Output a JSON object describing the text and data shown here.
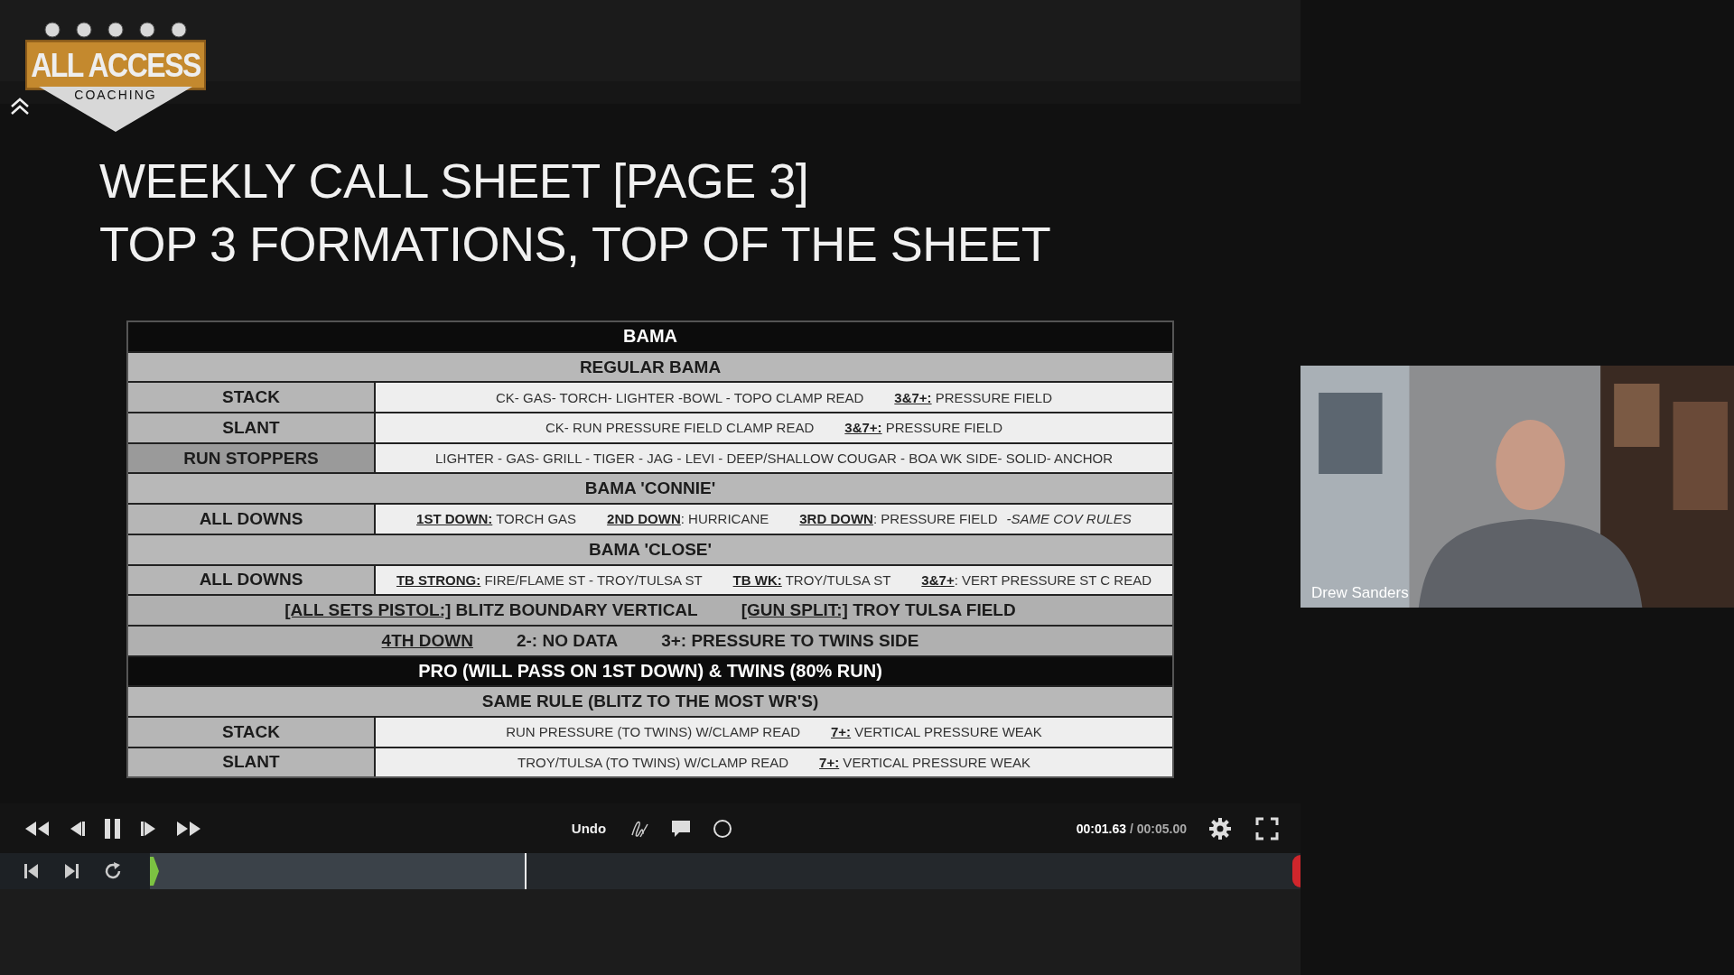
{
  "logo": {
    "title": "ALL ACCESS",
    "subtitle": "COACHING"
  },
  "slide": {
    "title_lines": [
      "WEEKLY CALL SHEET [PAGE 3]",
      "TOP 3 FORMATIONS, TOP OF THE SHEET"
    ],
    "table": {
      "rows": [
        {
          "kind": "header",
          "text": "BAMA"
        },
        {
          "kind": "section",
          "text": "REGULAR BAMA"
        },
        {
          "kind": "entry",
          "label": "STACK",
          "shaded": false,
          "groups": [
            [
              {
                "kind": "plain",
                "text": "CK- GAS- TORCH- LIGHTER -BOWL - TOPO  CLAMP READ"
              }
            ],
            [
              {
                "kind": "key",
                "text": "3&7+:"
              },
              {
                "kind": "plain",
                "text": " PRESSURE FIELD"
              }
            ]
          ]
        },
        {
          "kind": "entry",
          "label": "SLANT",
          "shaded": false,
          "groups": [
            [
              {
                "kind": "plain",
                "text": "CK- RUN PRESSURE FIELD CLAMP READ"
              }
            ],
            [
              {
                "kind": "key",
                "text": "3&7+:"
              },
              {
                "kind": "plain",
                "text": " PRESSURE FIELD"
              }
            ]
          ]
        },
        {
          "kind": "entry",
          "label": "RUN STOPPERS",
          "shaded": true,
          "groups": [
            [
              {
                "kind": "plain",
                "text": "LIGHTER - GAS- GRILL - TIGER - JAG - LEVI - DEEP/SHALLOW COUGAR - BOA WK SIDE- SOLID- ANCHOR"
              }
            ]
          ]
        },
        {
          "kind": "section",
          "text": "BAMA 'CONNIE'"
        },
        {
          "kind": "entry",
          "label": "ALL DOWNS",
          "shaded": false,
          "groups": [
            [
              {
                "kind": "key",
                "text": "1ST DOWN:"
              },
              {
                "kind": "plain",
                "text": " TORCH GAS"
              }
            ],
            [
              {
                "kind": "key",
                "text": "2ND DOWN"
              },
              {
                "kind": "plain",
                "text": ": HURRICANE"
              }
            ],
            [
              {
                "kind": "key",
                "text": "3RD DOWN"
              },
              {
                "kind": "plain",
                "text": ": PRESSURE FIELD"
              },
              {
                "kind": "note",
                "text": "-SAME COV RULES"
              }
            ]
          ]
        },
        {
          "kind": "section",
          "text": "BAMA 'CLOSE'"
        },
        {
          "kind": "entry",
          "label": "ALL DOWNS",
          "shaded": false,
          "groups": [
            [
              {
                "kind": "key",
                "text": "TB STRONG:"
              },
              {
                "kind": "plain",
                "text": " FIRE/FLAME ST - TROY/TULSA ST"
              }
            ],
            [
              {
                "kind": "key",
                "text": "TB WK:"
              },
              {
                "kind": "plain",
                "text": " TROY/TULSA ST"
              }
            ],
            [
              {
                "kind": "key",
                "text": "3&7+"
              },
              {
                "kind": "plain",
                "text": ":  VERT PRESSURE ST C READ"
              }
            ]
          ]
        },
        {
          "kind": "band",
          "groups": [
            [
              {
                "kind": "key",
                "text": "[ALL SETS PISTOL:]"
              },
              {
                "kind": "plain",
                "text": " BLITZ BOUNDARY VERTICAL"
              }
            ],
            [
              {
                "kind": "key",
                "text": "[GUN SPLIT:]"
              },
              {
                "kind": "plain",
                "text": " TROY TULSA FIELD"
              }
            ]
          ]
        },
        {
          "kind": "band",
          "groups": [
            [
              {
                "kind": "key",
                "text": "4TH DOWN"
              }
            ],
            [
              {
                "kind": "plain",
                "text": "2-: NO DATA"
              }
            ],
            [
              {
                "kind": "plain",
                "text": "3+: PRESSURE TO TWINS SIDE"
              }
            ]
          ]
        },
        {
          "kind": "header",
          "text": "PRO (WILL PASS ON 1ST DOWN) & TWINS (80% RUN)"
        },
        {
          "kind": "section",
          "text": "SAME RULE (BLITZ TO THE MOST WR'S)"
        },
        {
          "kind": "entry",
          "label": "STACK",
          "shaded": false,
          "groups": [
            [
              {
                "kind": "plain",
                "text": "RUN PRESSURE (TO TWINS) W/CLAMP READ"
              }
            ],
            [
              {
                "kind": "key",
                "text": "7+:"
              },
              {
                "kind": "plain",
                "text": " VERTICAL PRESSURE WEAK"
              }
            ]
          ]
        },
        {
          "kind": "entry",
          "label": "SLANT",
          "shaded": false,
          "groups": [
            [
              {
                "kind": "plain",
                "text": "TROY/TULSA (TO TWINS) W/CLAMP READ"
              }
            ],
            [
              {
                "kind": "key",
                "text": "7+:"
              },
              {
                "kind": "plain",
                "text": " VERTICAL PRESSURE WEAK"
              }
            ]
          ]
        }
      ]
    }
  },
  "player": {
    "playing": true,
    "undo": "Undo",
    "time_current": "00:01.63",
    "time_separator": "/",
    "time_total": "00:05.00",
    "playhead": {
      "level": 0.326
    }
  },
  "webcam": {
    "kind": "picture",
    "name": "Drew Sanders"
  }
}
